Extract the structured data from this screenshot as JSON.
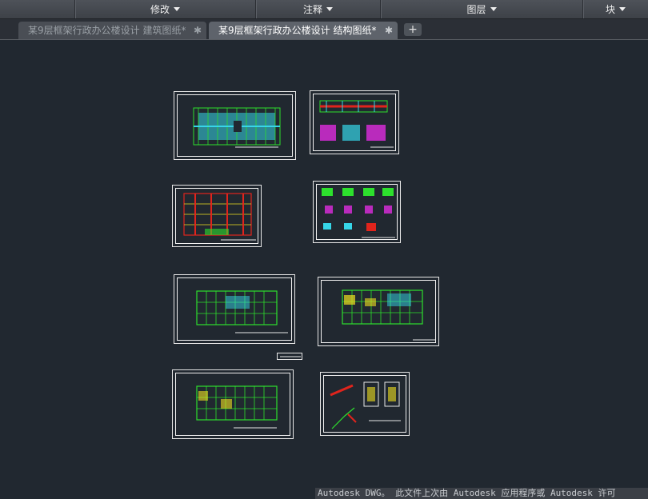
{
  "ribbon": {
    "panels": [
      {
        "label": "修改"
      },
      {
        "label": "注释"
      },
      {
        "label": "图层"
      },
      {
        "label": "块"
      }
    ]
  },
  "tabs": [
    {
      "title": "某9层框架行政办公楼设计 建筑图纸*",
      "close": "✱"
    },
    {
      "title": "某9层框架行政办公楼设计 结构图纸*",
      "close": "✱"
    }
  ],
  "new_tab": "+",
  "drawing": {
    "sheets": [
      {
        "name": "foundation-plan"
      },
      {
        "name": "beam-elevation"
      },
      {
        "name": "column-plan"
      },
      {
        "name": "detail-sheet"
      },
      {
        "name": "floor-plan-a"
      },
      {
        "name": "floor-plan-b"
      },
      {
        "name": "floor-plan-c"
      },
      {
        "name": "stair-detail"
      }
    ]
  },
  "status": {
    "text": "Autodesk DWG。  此文件上次由 Autodesk 应用程序或 Autodesk 许可"
  },
  "colors": {
    "canvas_bg": "#212830",
    "green": "#2de02d",
    "cyan": "#36d6e8",
    "red": "#e0241c",
    "yellow": "#f0e020",
    "magenta": "#e02ce0"
  }
}
